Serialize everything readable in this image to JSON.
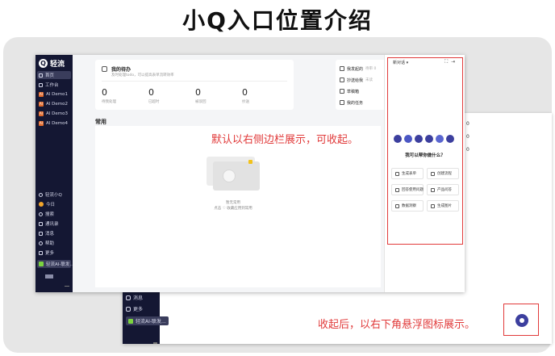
{
  "title": "小Q入口位置介绍",
  "captions": {
    "expanded": "默认以右侧边栏展示，可收起。",
    "collapsed": "收起后，以右下角悬浮图标展示。"
  },
  "colors": {
    "sidebar": "#141733",
    "annotation": "#e13a3a",
    "assistant": "#3c3f9e"
  },
  "app": {
    "logo": "Q",
    "name": "轻流",
    "nav": [
      {
        "label": "首页",
        "type": "icon"
      },
      {
        "label": "工作台",
        "type": "icon"
      },
      {
        "label": "AI Demo1",
        "type": "ai"
      },
      {
        "label": "AI Demo2",
        "type": "ai"
      },
      {
        "label": "AI Demo3",
        "type": "ai"
      },
      {
        "label": "AI Demo4",
        "type": "ai"
      }
    ],
    "bottom_nav": [
      {
        "label": "轻流小Q",
        "type": "icon"
      },
      {
        "label": "今日",
        "type": "dot",
        "color": "#f2a52b"
      },
      {
        "label": "搜索",
        "type": "icon"
      },
      {
        "label": "通讯录",
        "type": "icon"
      },
      {
        "label": "消息",
        "type": "icon"
      },
      {
        "label": "帮助",
        "type": "icon"
      },
      {
        "label": "更多",
        "type": "icon"
      },
      {
        "label": "轻流AI-联发...",
        "type": "project"
      }
    ],
    "todo": {
      "title": "我的待办",
      "subtitle": "及时处理todo，可以提高表单流转效率",
      "stats": [
        {
          "value": "0",
          "label": "待我处理"
        },
        {
          "value": "0",
          "label": "已超时"
        },
        {
          "value": "0",
          "label": "被驳回"
        },
        {
          "value": "0",
          "label": "抄送"
        }
      ]
    },
    "quick_list": [
      {
        "label": "我发起的",
        "tag": "待审 0",
        "count": "0"
      },
      {
        "label": "抄送给我",
        "tag": "未读",
        "count": "0"
      },
      {
        "label": "草稿箱",
        "tag": "",
        "count": "0"
      },
      {
        "label": "我的任务",
        "tag": "",
        "count": ""
      }
    ],
    "common_label": "常用",
    "empty_line1": "暂无常用",
    "empty_line2": "点击 ♡ 收藏应用到常用"
  },
  "assistant_panel": {
    "title": "新对话",
    "greeting": "我可以帮你做什么？",
    "actions": [
      "生成表单",
      "创建流程",
      "回答使用问题",
      "产品问答",
      "数据洞察",
      "生成图片"
    ]
  },
  "collapsed_view": {
    "nav": [
      {
        "label": "消息"
      },
      {
        "label": "更多"
      },
      {
        "label": "轻流AI-联发..."
      }
    ],
    "right_col": [
      "0",
      "0",
      "0"
    ]
  }
}
